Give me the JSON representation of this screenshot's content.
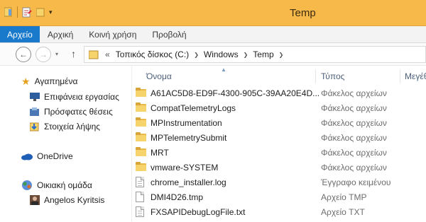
{
  "window": {
    "title": "Temp"
  },
  "ribbon": {
    "tabs": [
      {
        "label": "Αρχείο"
      },
      {
        "label": "Αρχική"
      },
      {
        "label": "Κοινή χρήση"
      },
      {
        "label": "Προβολή"
      }
    ]
  },
  "address": {
    "overflow": "«",
    "crumbs": [
      "Τοπικός δίσκος (C:)",
      "Windows",
      "Temp"
    ]
  },
  "nav": {
    "favorites": {
      "label": "Αγαπημένα"
    },
    "items": [
      {
        "label": "Επιφάνεια εργασίας",
        "icon": "desktop-icon"
      },
      {
        "label": "Πρόσφατες θέσεις",
        "icon": "recent-places-icon"
      },
      {
        "label": "Στοιχεία λήψης",
        "icon": "downloads-icon"
      }
    ],
    "onedrive": {
      "label": "OneDrive"
    },
    "homegroup": {
      "label": "Οικιακή ομάδα"
    },
    "user": {
      "label": "Angelos Kyritsis"
    }
  },
  "columns": {
    "name": "Όνομα",
    "type": "Τύπος",
    "size": "Μεγέθ"
  },
  "files": [
    {
      "name": "A61AC5D8-ED9F-4300-905C-39AA20E4D...",
      "type": "Φάκελος αρχείων",
      "kind": "folder"
    },
    {
      "name": "CompatTelemetryLogs",
      "type": "Φάκελος αρχείων",
      "kind": "folder"
    },
    {
      "name": "MPInstrumentation",
      "type": "Φάκελος αρχείων",
      "kind": "folder"
    },
    {
      "name": "MPTelemetrySubmit",
      "type": "Φάκελος αρχείων",
      "kind": "folder"
    },
    {
      "name": "MRT",
      "type": "Φάκελος αρχείων",
      "kind": "folder"
    },
    {
      "name": "vmware-SYSTEM",
      "type": "Φάκελος αρχείων",
      "kind": "folder"
    },
    {
      "name": "chrome_installer.log",
      "type": "Έγγραφο κειμένου",
      "kind": "file"
    },
    {
      "name": "DMI4D26.tmp",
      "type": "Αρχείο TMP",
      "kind": "file"
    },
    {
      "name": "FXSAPIDebugLogFile.txt",
      "type": "Αρχείο TXT",
      "kind": "file"
    }
  ],
  "colors": {
    "titlebar": "#f6b94a",
    "file_tab": "#1979ca",
    "folder": "#e9b949"
  }
}
